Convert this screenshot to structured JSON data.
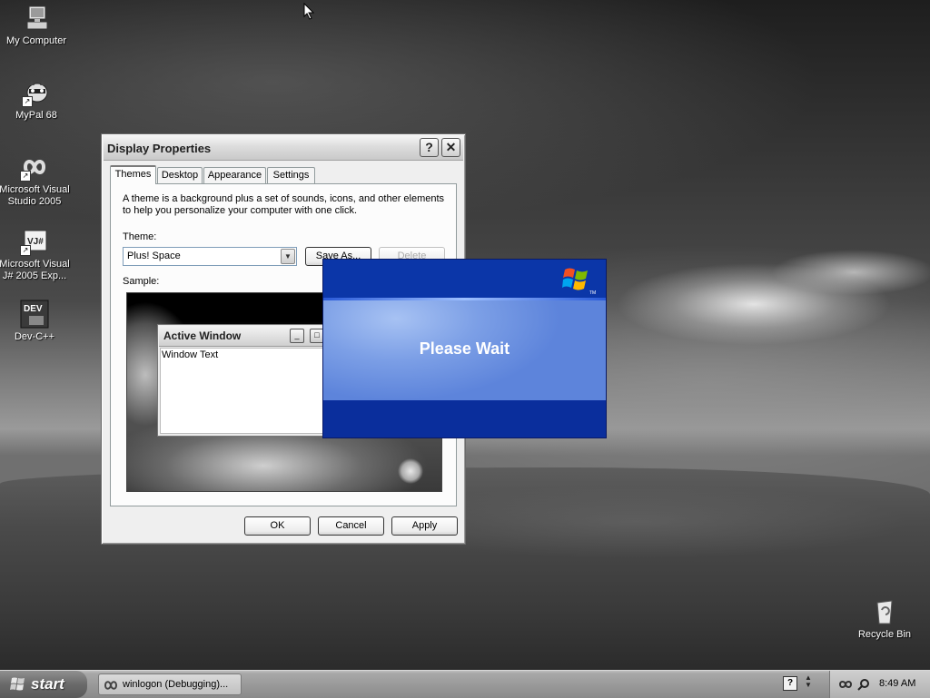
{
  "desktop": {
    "icons": [
      {
        "label": "My Computer"
      },
      {
        "label": "MyPal 68"
      },
      {
        "label": "Microsoft Visual Studio 2005"
      },
      {
        "label": "Microsoft Visual J# 2005 Exp..."
      },
      {
        "label": "Dev-C++"
      },
      {
        "label": "Recycle Bin"
      }
    ],
    "devcpp_icon_text": "DEV",
    "vj_icon_text": "VJ#"
  },
  "dialog": {
    "title": "Display Properties",
    "help_button": "?",
    "close_button": "✕",
    "tabs": [
      {
        "label": "Themes"
      },
      {
        "label": "Desktop"
      },
      {
        "label": "Appearance"
      },
      {
        "label": "Settings"
      }
    ],
    "description": "A theme is a background plus a set of sounds, icons, and other elements to help you personalize your computer with one click.",
    "theme_label": "Theme:",
    "theme_value": "Plus! Space",
    "save_as_label": "Save As...",
    "delete_label": "Delete",
    "sample_label": "Sample:",
    "sample_window": {
      "title": "Active Window",
      "minimize": "_",
      "maximize": "□",
      "text": "Window Text"
    },
    "ok_label": "OK",
    "cancel_label": "Cancel",
    "apply_label": "Apply"
  },
  "splash": {
    "text": "Please Wait",
    "tm": "TM"
  },
  "taskbar": {
    "start_label": "start",
    "task_label": "winlogon (Debugging)...",
    "help_glyph": "?",
    "clock": "8:49 AM"
  },
  "colors": {
    "splash_blue": "#0a2e9c",
    "splash_light": "#7c9fe6"
  }
}
